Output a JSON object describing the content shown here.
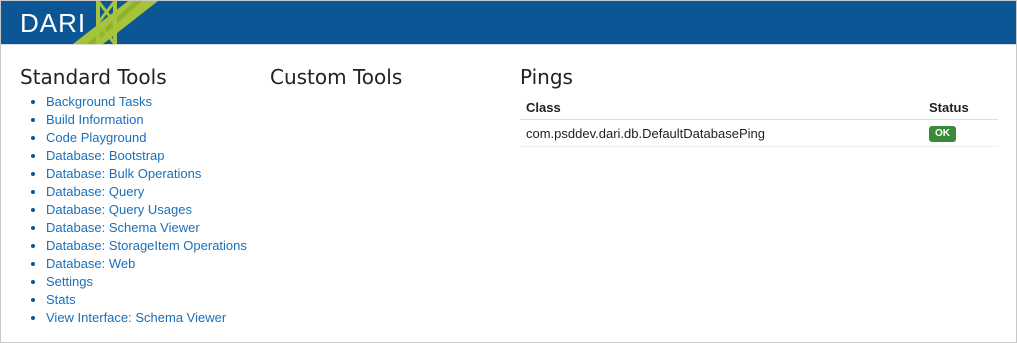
{
  "header": {
    "brand": "DARI",
    "colors": {
      "bar": "#0b5796",
      "accent": "#a5c43a"
    }
  },
  "standard_tools": {
    "title": "Standard Tools",
    "items": [
      "Background Tasks",
      "Build Information",
      "Code Playground",
      "Database: Bootstrap",
      "Database: Bulk Operations",
      "Database: Query",
      "Database: Query Usages",
      "Database: Schema Viewer",
      "Database: StorageItem Operations",
      "Database: Web",
      "Settings",
      "Stats",
      "View Interface: Schema Viewer"
    ]
  },
  "custom_tools": {
    "title": "Custom Tools"
  },
  "pings": {
    "title": "Pings",
    "columns": {
      "class": "Class",
      "status": "Status"
    },
    "rows": [
      {
        "class": "com.psddev.dari.db.DefaultDatabasePing",
        "status": "OK",
        "status_color": "#3a8a3a"
      }
    ]
  }
}
